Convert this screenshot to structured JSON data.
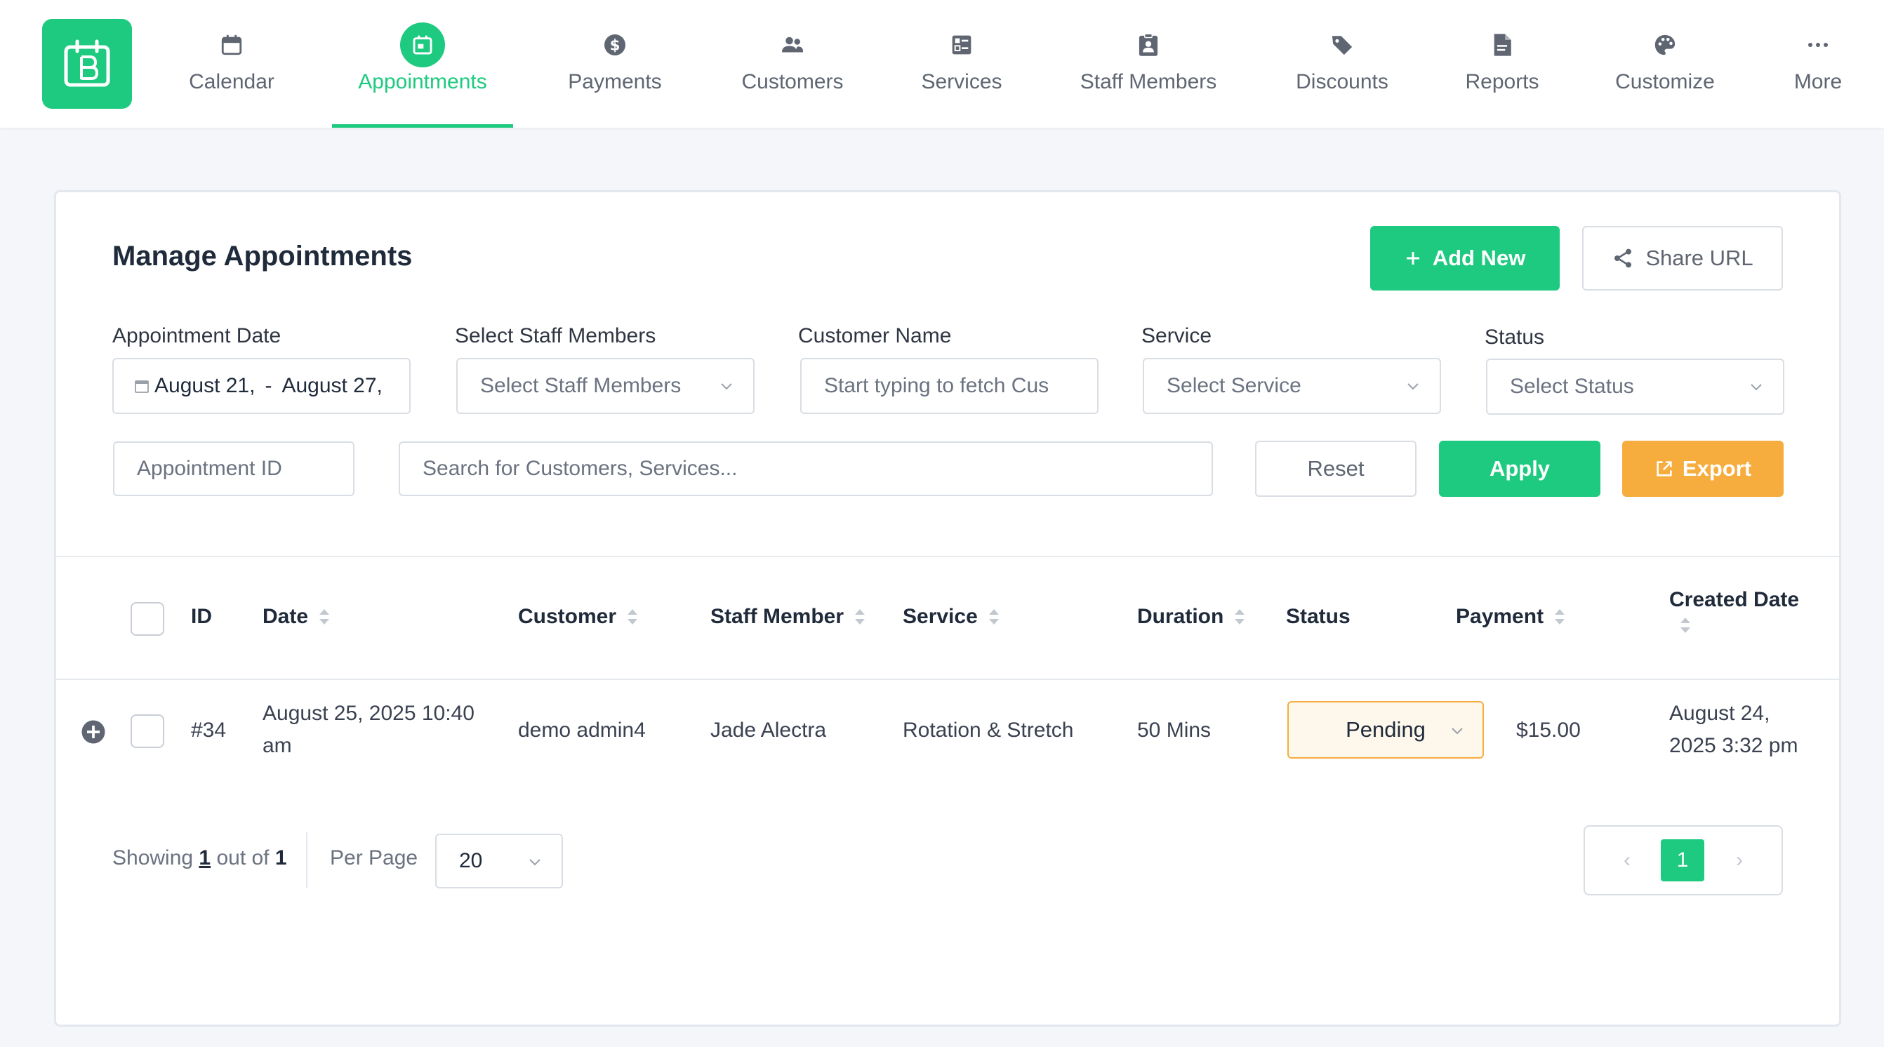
{
  "nav": {
    "items": [
      {
        "label": "Calendar",
        "icon": "calendar-icon"
      },
      {
        "label": "Appointments",
        "icon": "appointments-icon",
        "active": true
      },
      {
        "label": "Payments",
        "icon": "dollar-icon"
      },
      {
        "label": "Customers",
        "icon": "users-icon"
      },
      {
        "label": "Services",
        "icon": "services-icon"
      },
      {
        "label": "Staff Members",
        "icon": "badge-icon"
      },
      {
        "label": "Discounts",
        "icon": "tag-icon"
      },
      {
        "label": "Reports",
        "icon": "report-icon"
      },
      {
        "label": "Customize",
        "icon": "palette-icon"
      },
      {
        "label": "More",
        "icon": "more-icon"
      }
    ]
  },
  "page": {
    "title": "Manage Appointments",
    "add_new_label": "Add New",
    "share_url_label": "Share URL"
  },
  "filters": {
    "appointment_date_label": "Appointment Date",
    "date_from": "August 21,",
    "date_sep": "-",
    "date_to": "August 27,",
    "staff_label": "Select Staff Members",
    "staff_placeholder": "Select Staff Members",
    "customer_label": "Customer Name",
    "customer_placeholder": "Start typing to fetch Cus",
    "service_label": "Service",
    "service_placeholder": "Select Service",
    "status_label": "Status",
    "status_placeholder": "Select Status",
    "appointment_id_placeholder": "Appointment ID",
    "search_placeholder": "Search for Customers, Services...",
    "reset_label": "Reset",
    "apply_label": "Apply",
    "export_label": "Export"
  },
  "table": {
    "headers": {
      "id": "ID",
      "date": "Date",
      "customer": "Customer",
      "staff": "Staff Member",
      "service": "Service",
      "duration": "Duration",
      "status": "Status",
      "payment": "Payment",
      "created": "Created Date"
    },
    "rows": [
      {
        "id": "#34",
        "date": "August 25, 2025 10:40 am",
        "customer": "demo admin4",
        "staff": "Jade Alectra",
        "service": "Rotation & Stretch",
        "duration": "50 Mins",
        "status": "Pending",
        "payment": "$15.00",
        "created": "August 24, 2025 3:32 pm"
      }
    ]
  },
  "footer": {
    "showing_prefix": "Showing ",
    "showing_current": "1",
    "showing_middle": " out of ",
    "showing_total": "1",
    "per_page_label": "Per Page",
    "per_page_value": "20",
    "prev": "‹",
    "current_page": "1",
    "next": "›"
  },
  "colors": {
    "accent": "#1dca7f",
    "export": "#f6ad3e",
    "pending_bg": "#fef8ec"
  }
}
